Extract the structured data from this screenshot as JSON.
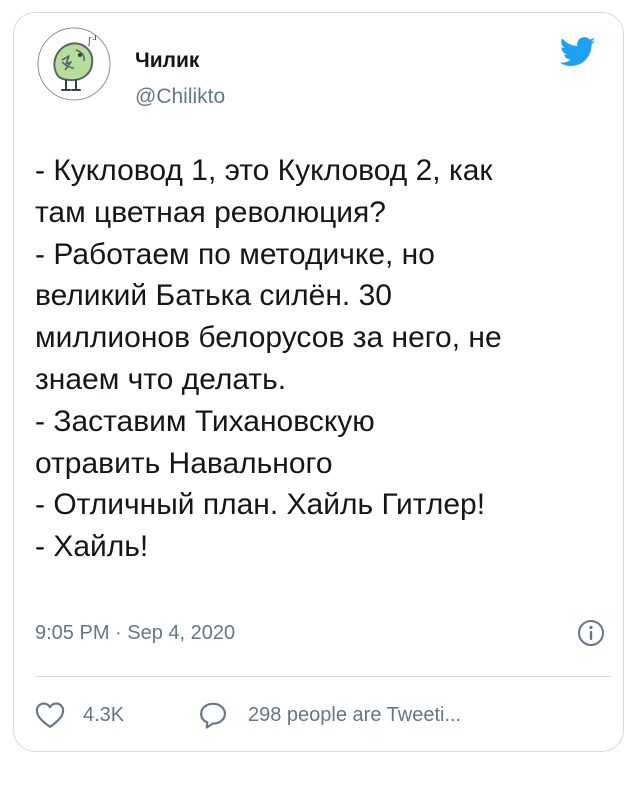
{
  "tweet": {
    "author": {
      "display_name": "Чилик",
      "handle": "@Chilikto",
      "avatar_icon": "green-bird-sketch-icon"
    },
    "brand_icon": "twitter-bird-icon",
    "lines": [
      "- Кукловод 1, это Кукловод 2, как",
      "там цветная революция?",
      "- Работаем по методичке, но",
      "великий Батька силён. 30",
      "миллионов белорусов за него, не",
      "знаем что делать.",
      "- Заставим Тихановскую",
      "отравить Навального",
      "- Отличный план. Хайль Гитлер!",
      "- Хайль!"
    ],
    "timestamp": "9:05 PM · Sep 4, 2020",
    "info_icon": "info-circle-icon",
    "actions": {
      "like_icon": "heart-outline-icon",
      "like_count": "4.3K",
      "reply_icon": "speech-bubble-icon",
      "reply_label": "298 people are Tweeti..."
    }
  },
  "colors": {
    "text_primary": "#14171a",
    "text_secondary": "#657786",
    "twitter_blue": "#1da1f2",
    "avatar_green": "#b5dd9c",
    "border": "#d6dadd"
  }
}
